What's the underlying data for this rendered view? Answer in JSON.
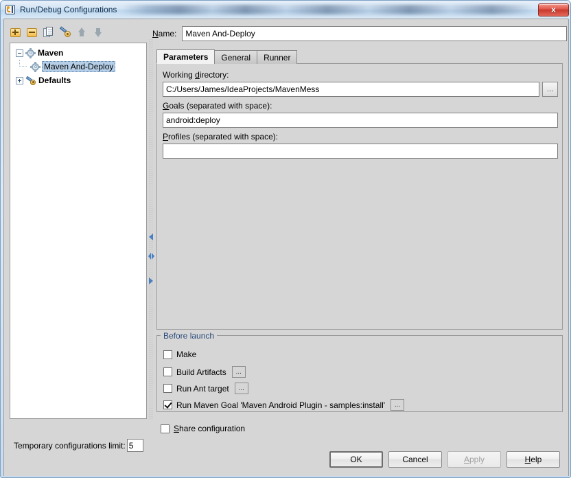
{
  "window": {
    "title": "Run/Debug Configurations",
    "app_icon": "intellij-idea-icon",
    "close_label": "x",
    "background_title_text": "(redacted)"
  },
  "toolbar": {
    "items": [
      {
        "name": "add-configuration-button",
        "icon": "plus-icon",
        "tooltip": "Add New Configuration"
      },
      {
        "name": "remove-configuration-button",
        "icon": "minus-icon",
        "tooltip": "Remove Configuration"
      },
      {
        "name": "copy-configuration-button",
        "icon": "copy-icon",
        "tooltip": "Copy Configuration"
      },
      {
        "name": "edit-defaults-button",
        "icon": "wrench-icon",
        "tooltip": "Edit defaults"
      },
      {
        "name": "move-up-button",
        "icon": "arrow-up-icon",
        "tooltip": "Move Up"
      },
      {
        "name": "move-down-button",
        "icon": "arrow-down-icon",
        "tooltip": "Move Down"
      }
    ]
  },
  "tree": {
    "nodes": [
      {
        "label": "Maven",
        "level": 0,
        "bold": true,
        "expanded": true,
        "icon": "gear-icon",
        "selected": false
      },
      {
        "label": "Maven And-Deploy",
        "level": 1,
        "bold": false,
        "icon": "gear-icon",
        "selected": true
      },
      {
        "label": "Defaults",
        "level": 0,
        "bold": true,
        "expanded": false,
        "icon": "wrench-icon",
        "selected": false
      }
    ]
  },
  "temp_limit": {
    "label": "Temporary configurations limit:",
    "value": "5"
  },
  "name_field": {
    "label": "Name:",
    "mnemonic": "N",
    "value": "Maven And-Deploy"
  },
  "tabs": [
    {
      "label": "Parameters",
      "active": true
    },
    {
      "label": "General",
      "active": false
    },
    {
      "label": "Runner",
      "active": false
    }
  ],
  "parameters": {
    "working_directory": {
      "label_prefix": "Working ",
      "label_mnemonic": "d",
      "label_suffix": "irectory:",
      "value": "C:/Users/James/IdeaProjects/MavenMess",
      "browse_label": "..."
    },
    "goals": {
      "label_mnemonic": "G",
      "label_suffix": "oals (separated with space):",
      "value": "android:deploy"
    },
    "profiles": {
      "label_mnemonic": "P",
      "label_suffix": "rofiles (separated with space):",
      "value": ""
    }
  },
  "before_launch": {
    "legend": "Before launch",
    "items": [
      {
        "label": "Make",
        "checked": false,
        "has_ellipsis": false
      },
      {
        "label": "Build Artifacts",
        "checked": false,
        "has_ellipsis": true
      },
      {
        "label": "Run Ant target",
        "checked": false,
        "has_ellipsis": true
      },
      {
        "label": "Run Maven Goal 'Maven Android Plugin - samples:install'",
        "checked": true,
        "has_ellipsis": true
      }
    ],
    "ellipsis_label": "..."
  },
  "share": {
    "label_mnemonic": "S",
    "label_suffix": "hare configuration",
    "checked": false
  },
  "buttons": [
    {
      "label": "OK",
      "name": "ok-button",
      "default": true,
      "disabled": false,
      "mnemonic": ""
    },
    {
      "label": "Cancel",
      "name": "cancel-button",
      "default": false,
      "disabled": false,
      "mnemonic": ""
    },
    {
      "label": "Apply",
      "name": "apply-button",
      "default": false,
      "disabled": true,
      "mnemonic": "A"
    },
    {
      "label": "Help",
      "name": "help-button",
      "default": false,
      "disabled": false,
      "mnemonic": "H"
    }
  ],
  "colors": {
    "panel_bg": "#d6d6d6",
    "tree_bg": "#ffffff",
    "selection": "#b6cfe8",
    "legend_text": "#2a4a7a",
    "close_red": "#c8382c",
    "splitter_arrow": "#4a7fc1"
  }
}
